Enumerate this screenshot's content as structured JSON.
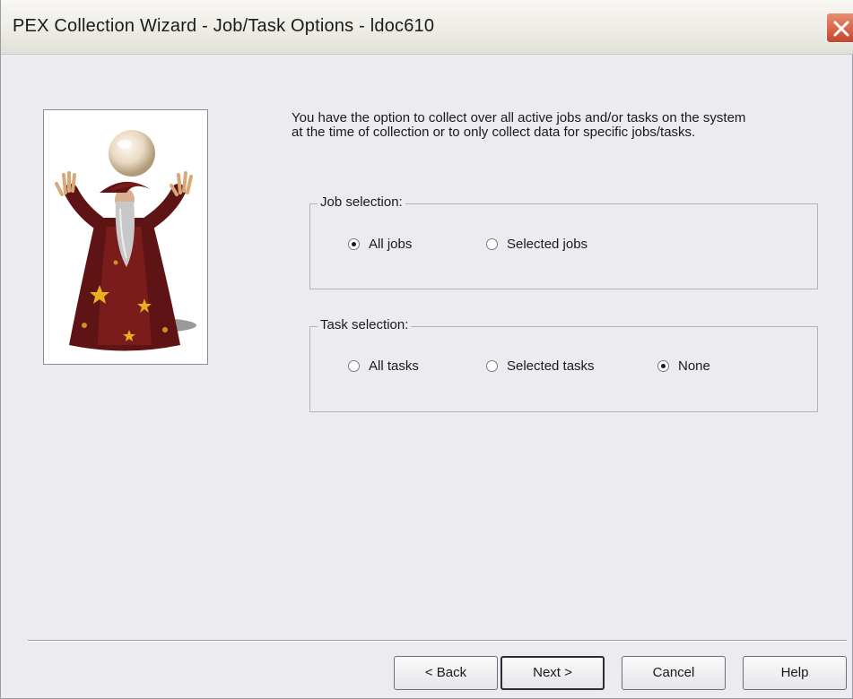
{
  "window": {
    "title": "PEX Collection Wizard - Job/Task Options - ldoc610"
  },
  "intro_text": "You have the option to collect over all active jobs and/or tasks on the system at the time of collection or to only collect data for specific jobs/tasks.",
  "job_selection": {
    "legend": "Job selection:",
    "options": [
      {
        "label": "All jobs",
        "checked": true
      },
      {
        "label": "Selected jobs",
        "checked": false
      }
    ]
  },
  "task_selection": {
    "legend": "Task selection:",
    "options": [
      {
        "label": "All tasks",
        "checked": false
      },
      {
        "label": "Selected tasks",
        "checked": false
      },
      {
        "label": "None",
        "checked": true
      }
    ]
  },
  "buttons": {
    "back": {
      "label": "< Back",
      "mnemonic": "B"
    },
    "next": {
      "label": "Next >",
      "mnemonic": "N"
    },
    "cancel": {
      "label": "Cancel"
    },
    "help": {
      "label": "Help"
    }
  },
  "icons": {
    "close": "close-icon",
    "wizard": "wizard-illustration"
  }
}
